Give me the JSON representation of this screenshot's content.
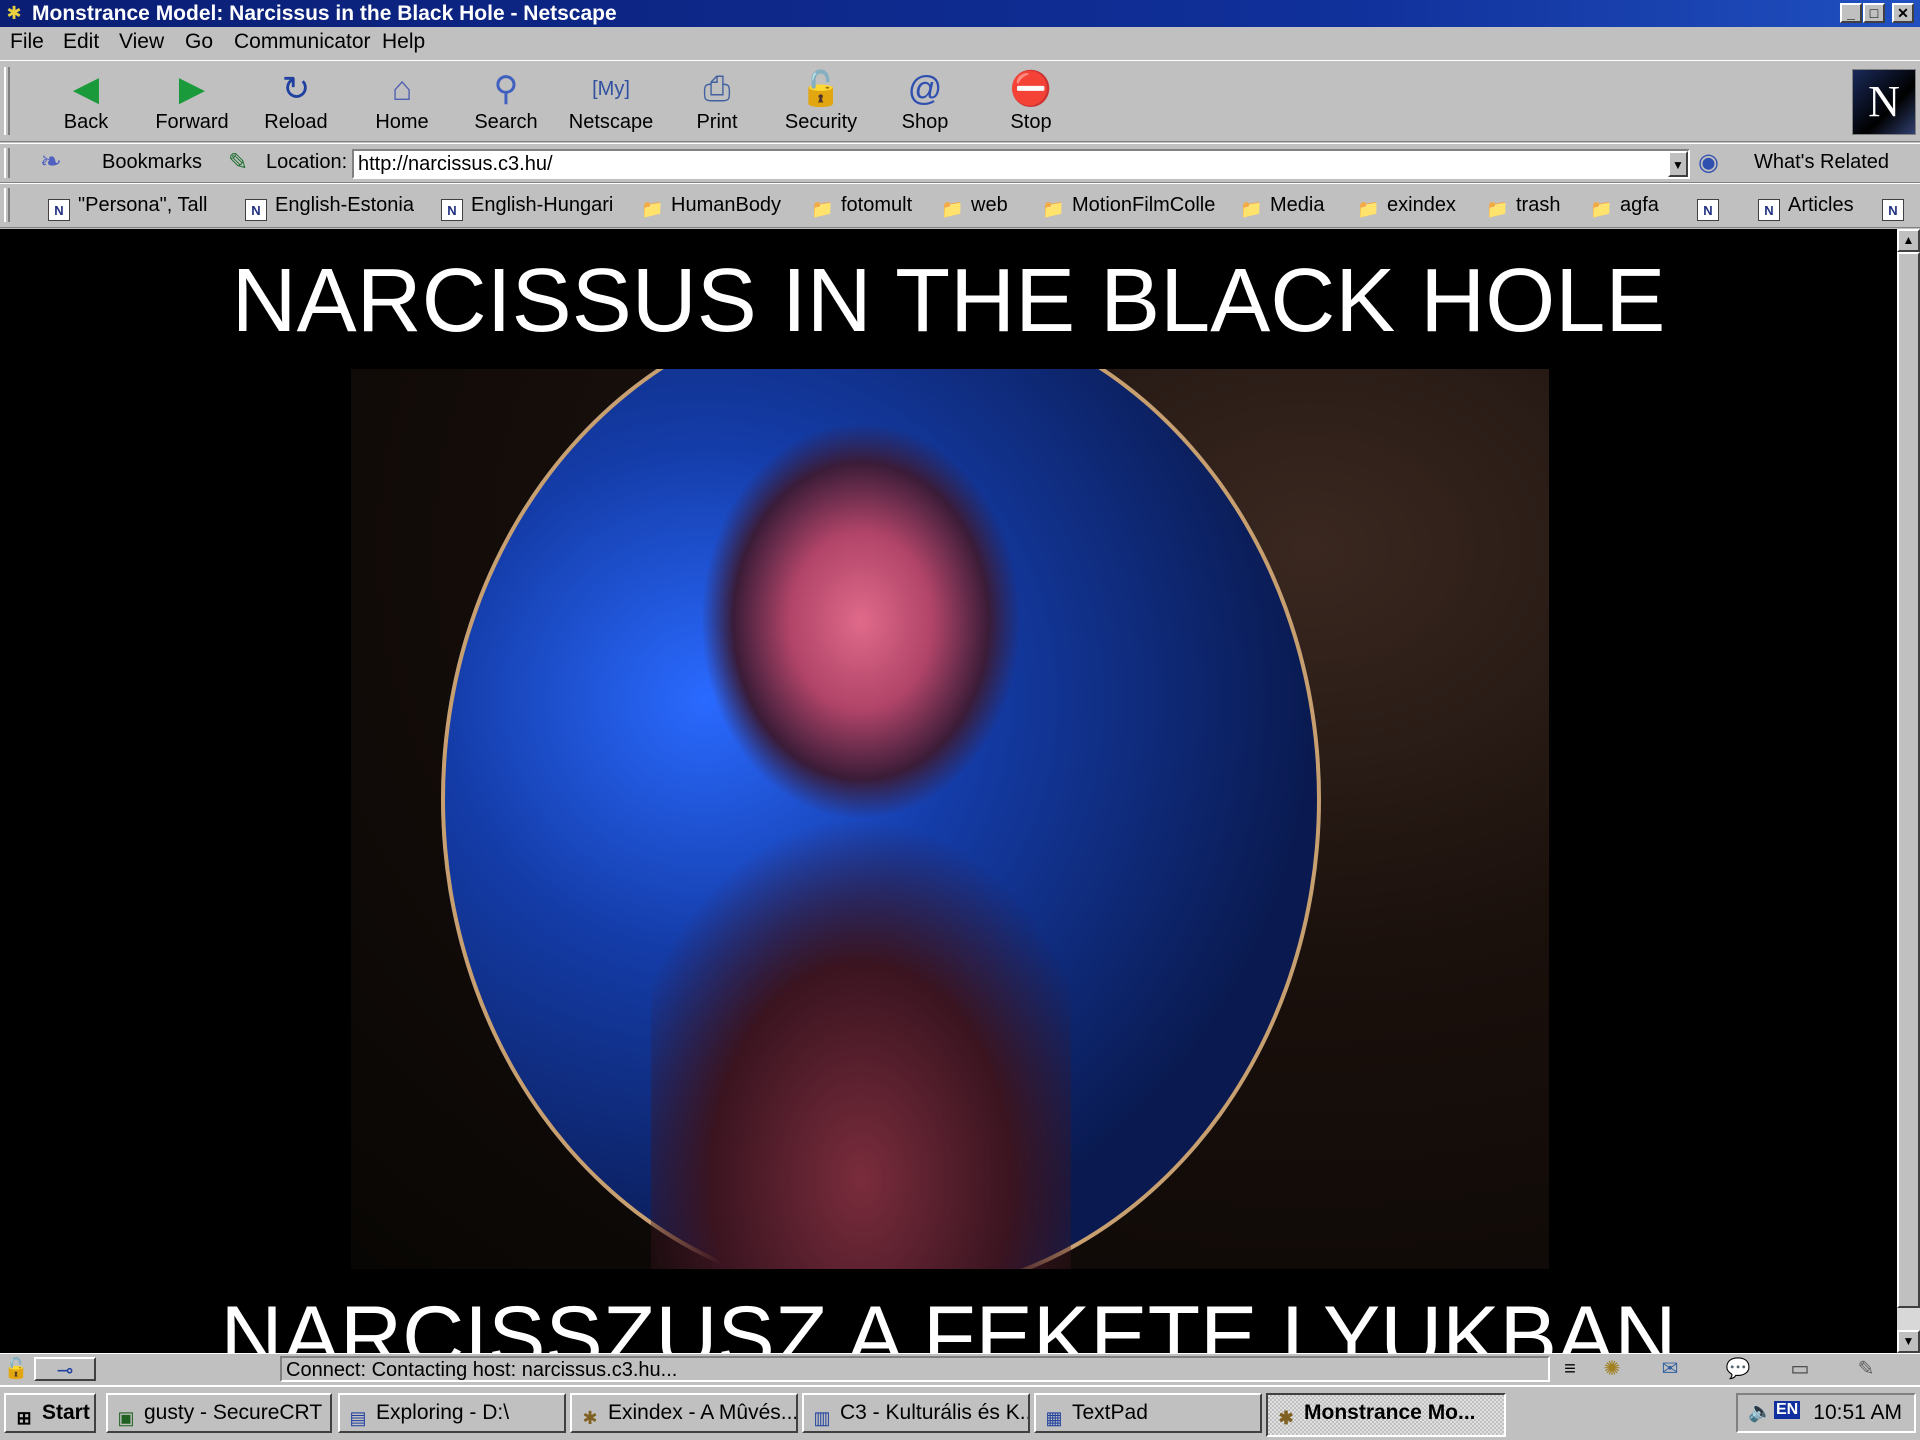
{
  "window": {
    "title": "Monstrance Model: Narcissus in the Black Hole - Netscape"
  },
  "menu": {
    "items": [
      "File",
      "Edit",
      "View",
      "Go",
      "Communicator",
      "Help"
    ]
  },
  "toolbar": {
    "buttons": [
      {
        "label": "Back",
        "icon": "back-arrow-icon"
      },
      {
        "label": "Forward",
        "icon": "forward-arrow-icon"
      },
      {
        "label": "Reload",
        "icon": "reload-icon"
      },
      {
        "label": "Home",
        "icon": "home-icon"
      },
      {
        "label": "Search",
        "icon": "search-icon"
      },
      {
        "label": "Netscape",
        "icon": "my-netscape-icon"
      },
      {
        "label": "Print",
        "icon": "print-icon"
      },
      {
        "label": "Security",
        "icon": "lock-icon"
      },
      {
        "label": "Shop",
        "icon": "shop-icon"
      },
      {
        "label": "Stop",
        "icon": "stop-icon"
      }
    ]
  },
  "locationbar": {
    "bookmarks_label": "Bookmarks",
    "location_label": "Location:",
    "url": "http://narcissus.c3.hu/",
    "whats_related": "What's Related"
  },
  "personal_toolbar": {
    "items": [
      {
        "label": "\"Persona\", Tall",
        "type": "page"
      },
      {
        "label": "English-Estonia",
        "type": "page"
      },
      {
        "label": "English-Hungari",
        "type": "page"
      },
      {
        "label": "HumanBody",
        "type": "folder"
      },
      {
        "label": "fotomult",
        "type": "folder"
      },
      {
        "label": "web",
        "type": "folder"
      },
      {
        "label": "MotionFilmColle",
        "type": "folder"
      },
      {
        "label": "Media",
        "type": "folder"
      },
      {
        "label": "exindex",
        "type": "folder"
      },
      {
        "label": "trash",
        "type": "folder"
      },
      {
        "label": "agfa",
        "type": "folder"
      },
      {
        "label": "Articles",
        "type": "page"
      }
    ]
  },
  "page": {
    "heading": "NARCISSUS IN THE BLACK HOLE",
    "subheading": "NARCISSZUSZ A FEKETE LYUKBAN"
  },
  "statusbar": {
    "text": "Connect: Contacting host: narcissus.c3.hu..."
  },
  "taskbar": {
    "start_label": "Start",
    "tasks": [
      {
        "label": "gusty - SecureCRT"
      },
      {
        "label": "Exploring - D:\\"
      },
      {
        "label": "Exindex - A Mûvés..."
      },
      {
        "label": "C3 - Kulturális és K..."
      },
      {
        "label": "TextPad"
      },
      {
        "label": "Monstrance Mo...",
        "active": true
      }
    ],
    "language": "EN",
    "clock": "10:51 AM"
  }
}
